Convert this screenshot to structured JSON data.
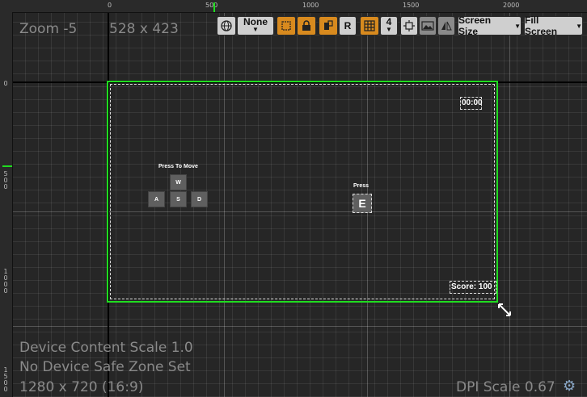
{
  "ruler": {
    "top_ticks": [
      "0",
      "500",
      "1000",
      "1500",
      "2000"
    ],
    "left_ticks": [
      "0",
      "500",
      "1000",
      "1500"
    ]
  },
  "overlay": {
    "zoom": "Zoom -5",
    "resolution": "528 x 423",
    "device_content_scale": "Device Content Scale 1.0",
    "safe_zone": "No Device Safe Zone Set",
    "screen_size": "1280 x 720 (16:9)",
    "dpi_scale": "DPI Scale 0.67"
  },
  "toolbar": {
    "none_label": "None",
    "r_label": "R",
    "grid_snap_value": "4",
    "screen_size_label": "Screen Size",
    "fill_screen_label": "Fill Screen",
    "icons": [
      "globe-icon",
      "transform-icon",
      "lock-icon",
      "localization-icon",
      "grid-icon",
      "fit-icon",
      "background-icon",
      "mirror-icon",
      "gear-icon",
      "resize-icon"
    ]
  },
  "hud": {
    "timer": "00:00",
    "score": "Score: 100",
    "move_hint_title": "Press To Move",
    "keys": {
      "w": "W",
      "a": "A",
      "s": "S",
      "d": "D"
    },
    "interact_title": "Press",
    "interact_key": "E"
  },
  "colors": {
    "frame_green": "#1fdc1f",
    "accent_orange": "#d88a1e",
    "background": "#262626"
  }
}
